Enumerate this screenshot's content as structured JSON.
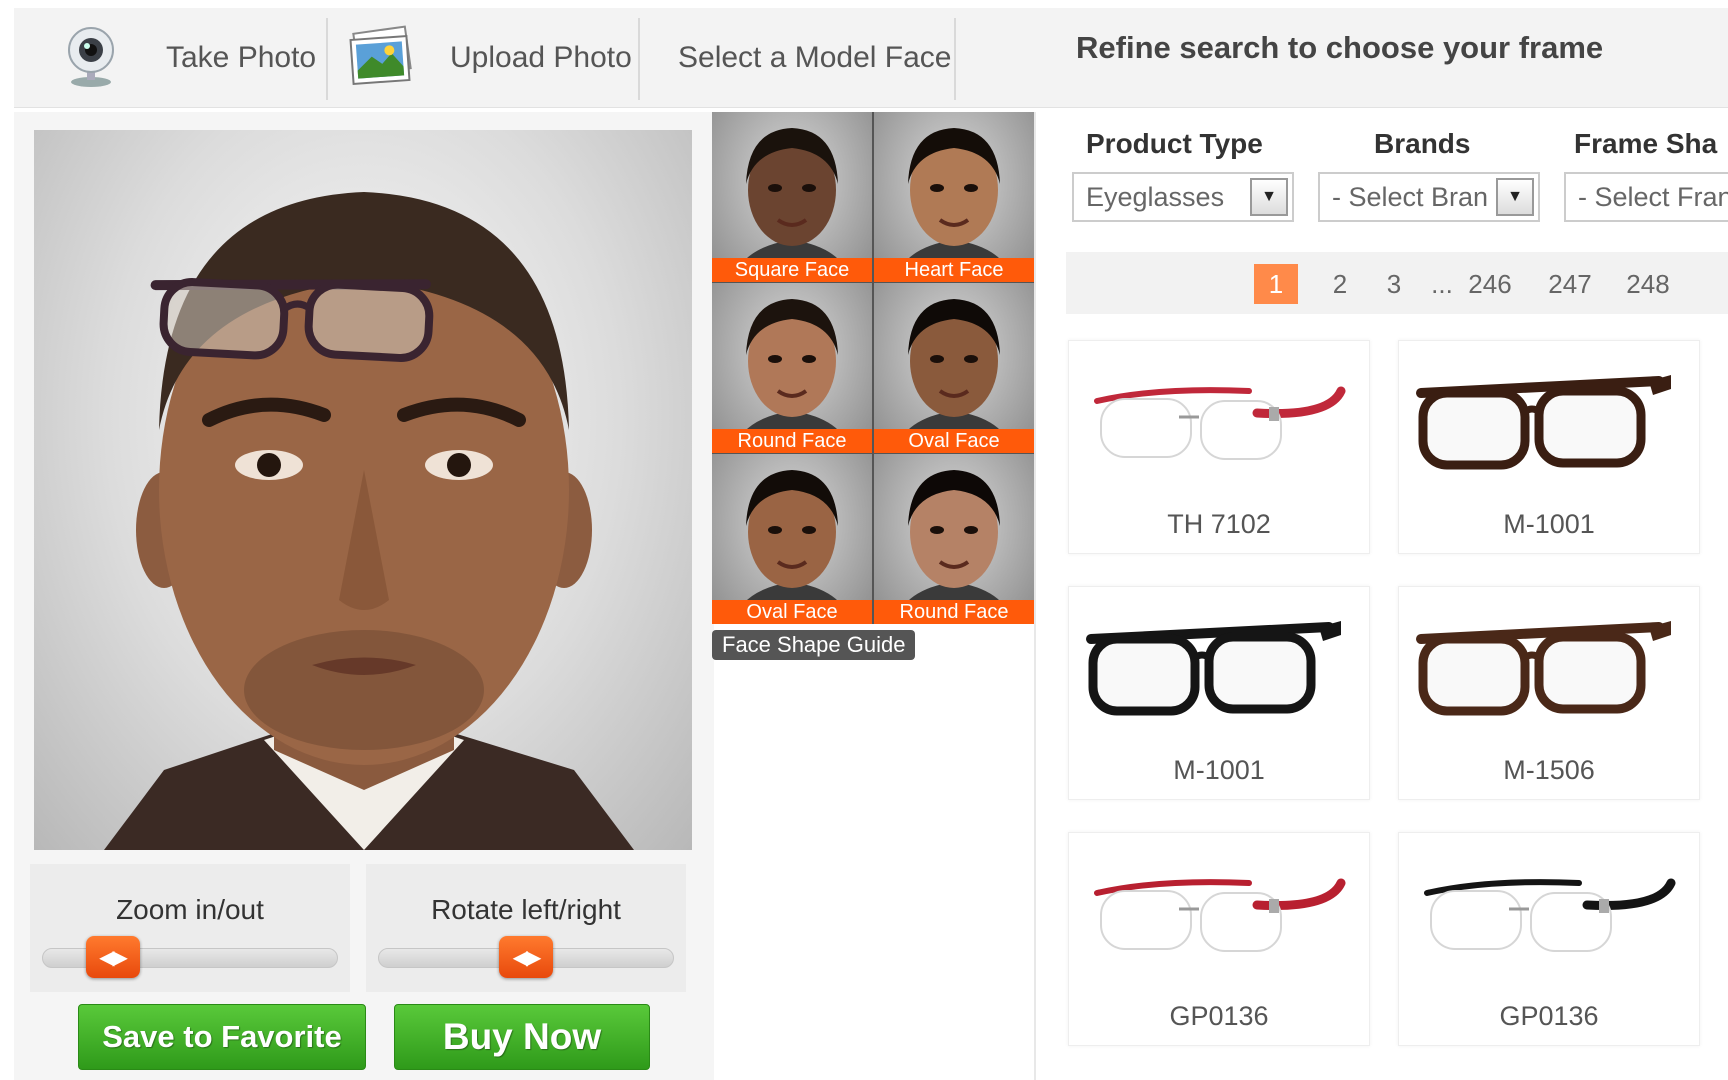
{
  "topbar": {
    "take_photo": "Take Photo",
    "upload_photo": "Upload Photo",
    "select_model": "Select a Model Face",
    "refine_title": "Refine search to choose your frame"
  },
  "controls": {
    "zoom_label": "Zoom in/out",
    "zoom_level": 0.18,
    "rotate_label": "Rotate left/right",
    "rotate_level": 0.5,
    "save_label": "Save to Favorite",
    "buy_label": "Buy Now"
  },
  "faces": {
    "items": [
      {
        "label": "Square Face",
        "skin": "#6b4430",
        "hair": "#1a120c"
      },
      {
        "label": "Heart Face",
        "skin": "#b07a55",
        "hair": "#140d08"
      },
      {
        "label": "Round Face",
        "skin": "#b07858",
        "hair": "#1c130d"
      },
      {
        "label": "Oval Face",
        "skin": "#8a5a3c",
        "hair": "#0f0a07"
      },
      {
        "label": "Oval Face",
        "skin": "#9a6444",
        "hair": "#120c08"
      },
      {
        "label": "Round Face",
        "skin": "#b58266",
        "hair": "#0d0806"
      }
    ],
    "guide_label": "Face Shape Guide"
  },
  "filters": {
    "product_type_label": "Product Type",
    "product_type_value": "Eyeglasses",
    "brands_label": "Brands",
    "brands_value": "- Select Bran",
    "frame_shape_label": "Frame Sha",
    "frame_shape_value": "- Select Fran"
  },
  "pagination": {
    "pages": [
      "1",
      "2",
      "3",
      "...",
      "246",
      "247",
      "248"
    ],
    "current": "1"
  },
  "products": [
    {
      "name": "TH 7102",
      "style": "rimless",
      "color": "#c0283a"
    },
    {
      "name": "M-1001",
      "style": "full",
      "color": "#3a1e12"
    },
    {
      "name": "M-1001",
      "style": "full",
      "color": "#151515"
    },
    {
      "name": "M-1506",
      "style": "full",
      "color": "#4a2818"
    },
    {
      "name": "GP0136",
      "style": "rimless",
      "color": "#b82030"
    },
    {
      "name": "GP0136",
      "style": "rimless",
      "color": "#141414"
    }
  ],
  "colors": {
    "accent_orange": "#ff5a0a",
    "button_green": "#3daa24",
    "page_active": "#ff8a4a"
  }
}
